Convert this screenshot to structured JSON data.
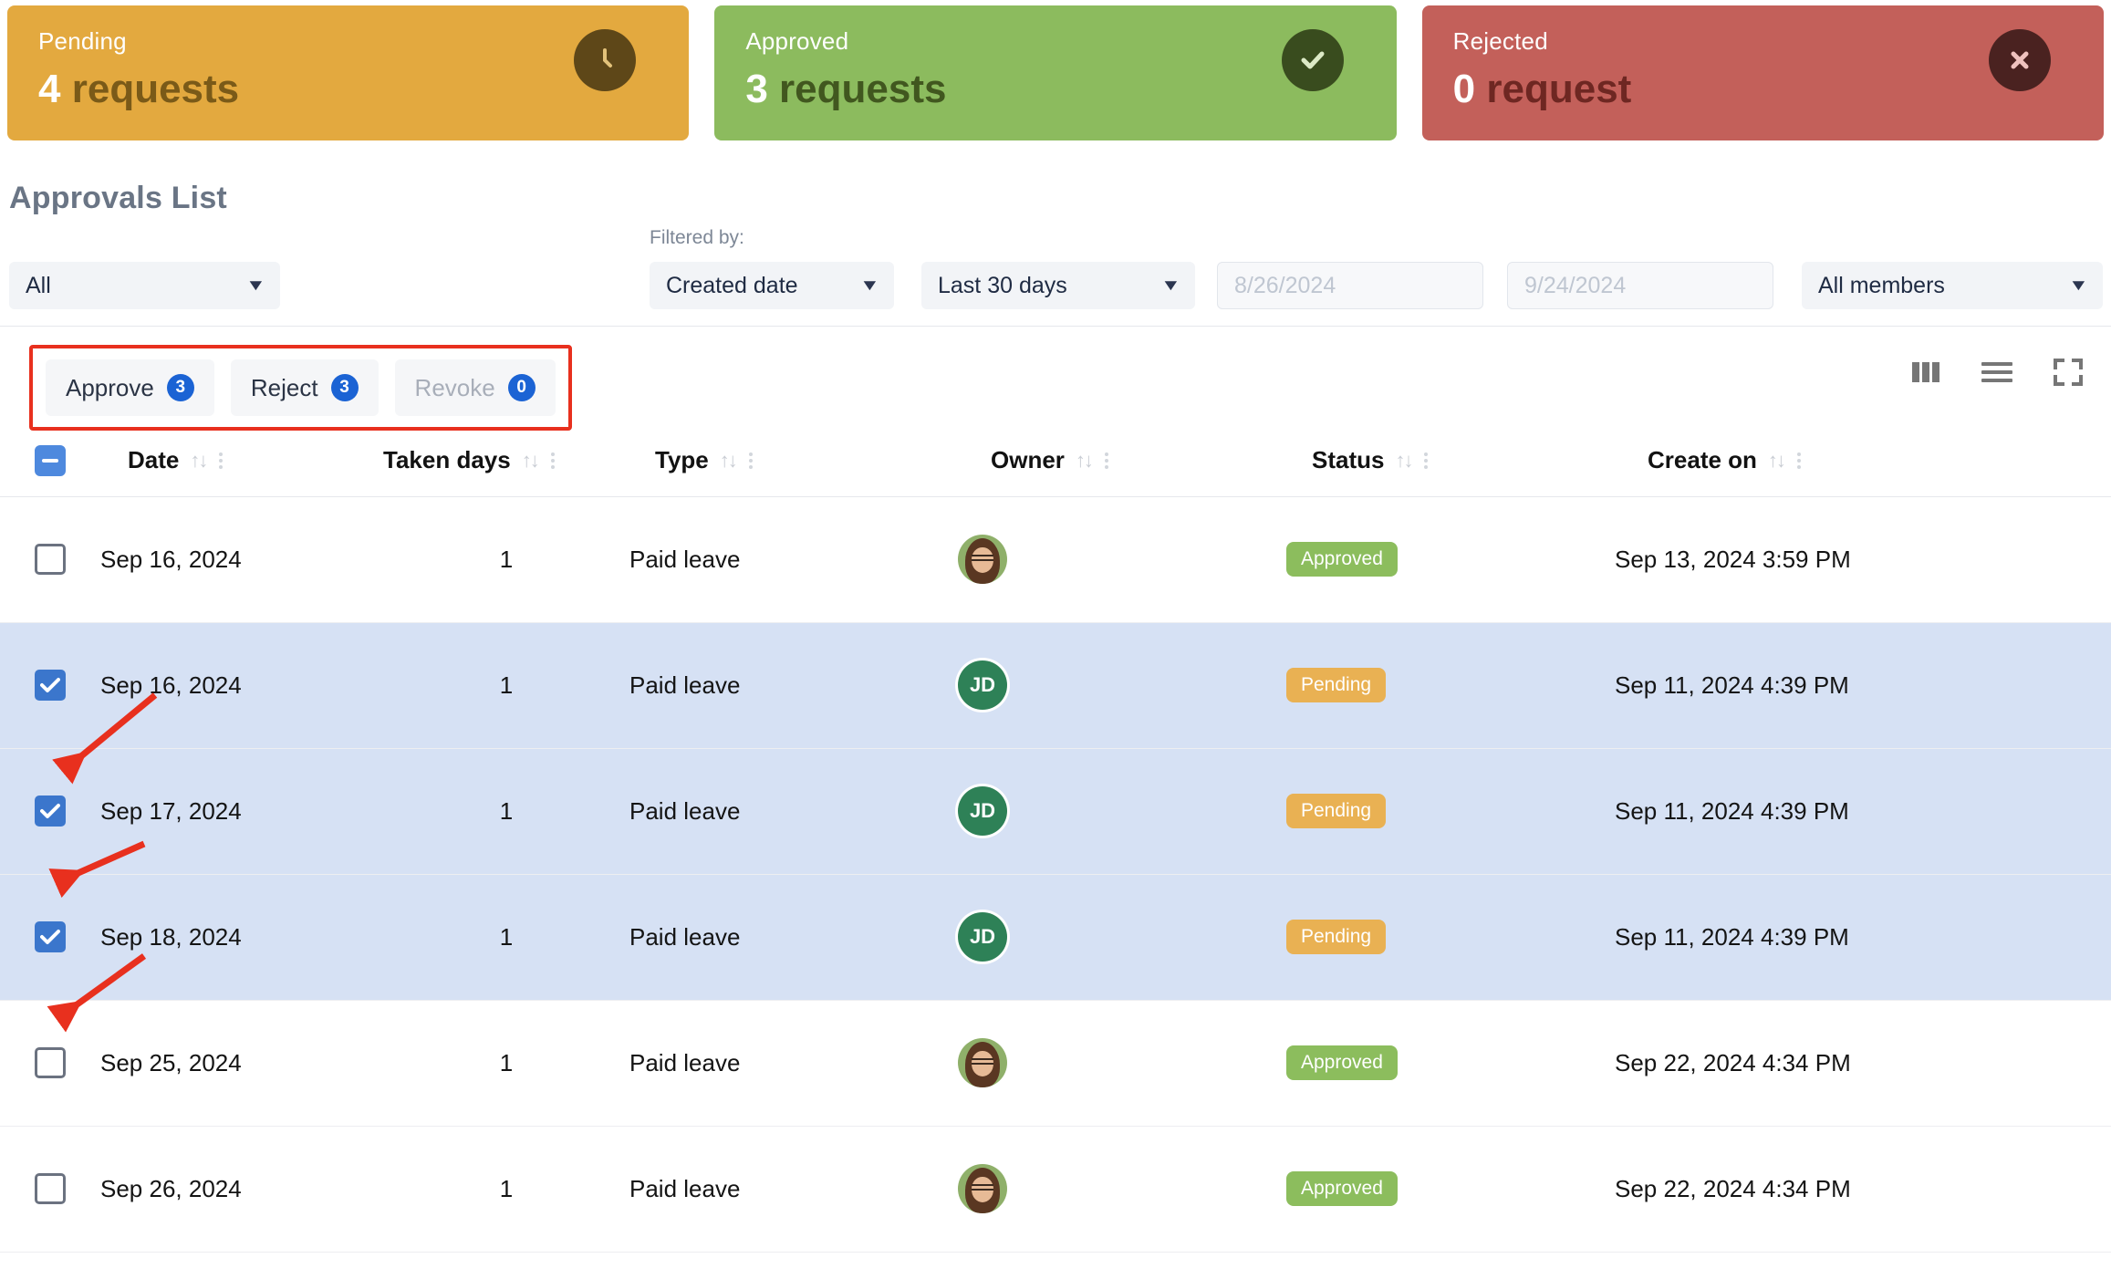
{
  "cards": [
    {
      "label": "Pending",
      "count": "4",
      "unit": "requests",
      "icon": "clock-icon",
      "color": "#E3A93F"
    },
    {
      "label": "Approved",
      "count": "3",
      "unit": "requests",
      "icon": "check-icon",
      "color": "#8CBB5E"
    },
    {
      "label": "Rejected",
      "count": "0",
      "unit": "request",
      "icon": "close-icon",
      "color": "#C3605A"
    }
  ],
  "section": {
    "title": "Approvals List"
  },
  "filters": {
    "filtered_by_label": "Filtered by:",
    "status_select": "All",
    "field_select": "Created date",
    "range_select": "Last 30 days",
    "date_from_placeholder": "8/26/2024",
    "date_to_placeholder": "9/24/2024",
    "members_select": "All members"
  },
  "toolbar": {
    "approve_label": "Approve",
    "approve_count": "3",
    "reject_label": "Reject",
    "reject_count": "3",
    "revoke_label": "Revoke",
    "revoke_count": "0",
    "icons": [
      "columns-icon",
      "list-icon",
      "fullscreen-icon"
    ]
  },
  "table": {
    "columns": [
      "Date",
      "Taken days",
      "Type",
      "Owner",
      "Status",
      "Create on"
    ],
    "rows": [
      {
        "selected": false,
        "date": "Sep 16, 2024",
        "taken_days": "1",
        "type": "Paid leave",
        "owner": {
          "kind": "photo",
          "initials": ""
        },
        "status": "Approved",
        "created": "Sep 13, 2024 3:59 PM"
      },
      {
        "selected": true,
        "date": "Sep 16, 2024",
        "taken_days": "1",
        "type": "Paid leave",
        "owner": {
          "kind": "initials",
          "initials": "JD"
        },
        "status": "Pending",
        "created": "Sep 11, 2024 4:39 PM"
      },
      {
        "selected": true,
        "date": "Sep 17, 2024",
        "taken_days": "1",
        "type": "Paid leave",
        "owner": {
          "kind": "initials",
          "initials": "JD"
        },
        "status": "Pending",
        "created": "Sep 11, 2024 4:39 PM"
      },
      {
        "selected": true,
        "date": "Sep 18, 2024",
        "taken_days": "1",
        "type": "Paid leave",
        "owner": {
          "kind": "initials",
          "initials": "JD"
        },
        "status": "Pending",
        "created": "Sep 11, 2024 4:39 PM"
      },
      {
        "selected": false,
        "date": "Sep 25, 2024",
        "taken_days": "1",
        "type": "Paid leave",
        "owner": {
          "kind": "photo",
          "initials": ""
        },
        "status": "Approved",
        "created": "Sep 22, 2024 4:34 PM"
      },
      {
        "selected": false,
        "date": "Sep 26, 2024",
        "taken_days": "1",
        "type": "Paid leave",
        "owner": {
          "kind": "photo",
          "initials": ""
        },
        "status": "Approved",
        "created": "Sep 22, 2024 4:34 PM"
      }
    ]
  },
  "annotations": {
    "highlight_color": "#E8301E",
    "arrow_color": "#E8301E",
    "arrow_count": 3
  }
}
